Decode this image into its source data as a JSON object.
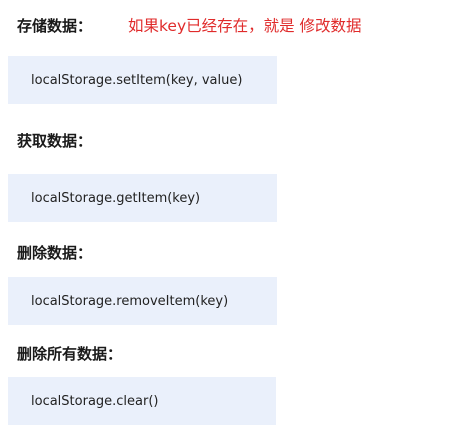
{
  "sections": [
    {
      "heading": "存储数据：",
      "note": "如果key已经存在，就是 修改数据",
      "code": "localStorage.setItem(key, value)"
    },
    {
      "heading": "获取数据：",
      "code": "localStorage.getItem(key)"
    },
    {
      "heading": "删除数据：",
      "code": "localStorage.removeItem(key)"
    },
    {
      "heading": "删除所有数据：",
      "code": "localStorage.clear()"
    }
  ],
  "colors": {
    "note": "#e02b2b",
    "code_background": "#eaf0fb",
    "heading": "#1a1a1a"
  }
}
